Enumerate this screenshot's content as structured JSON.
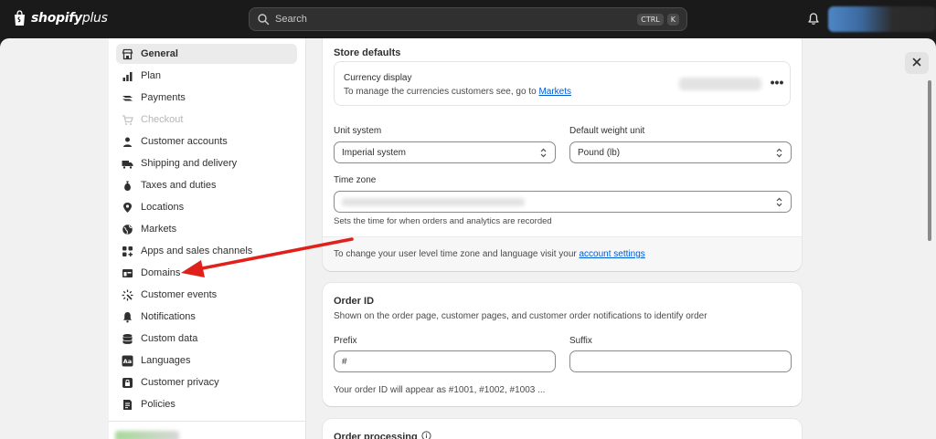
{
  "topbar": {
    "logo_text": "shopify",
    "logo_plus": "plus",
    "search_placeholder": "Search",
    "shortcut_key1": "CTRL",
    "shortcut_key2": "K"
  },
  "sidebar": {
    "items": [
      {
        "label": "General",
        "icon": "store-icon",
        "active": true
      },
      {
        "label": "Plan",
        "icon": "plan-icon"
      },
      {
        "label": "Payments",
        "icon": "payments-icon"
      },
      {
        "label": "Checkout",
        "icon": "cart-icon",
        "disabled": true
      },
      {
        "label": "Customer accounts",
        "icon": "person-icon"
      },
      {
        "label": "Shipping and delivery",
        "icon": "truck-icon"
      },
      {
        "label": "Taxes and duties",
        "icon": "tax-icon"
      },
      {
        "label": "Locations",
        "icon": "location-icon"
      },
      {
        "label": "Markets",
        "icon": "globe-icon"
      },
      {
        "label": "Apps and sales channels",
        "icon": "apps-icon"
      },
      {
        "label": "Domains",
        "icon": "domains-icon"
      },
      {
        "label": "Customer events",
        "icon": "events-icon"
      },
      {
        "label": "Notifications",
        "icon": "bell-icon"
      },
      {
        "label": "Custom data",
        "icon": "database-icon"
      },
      {
        "label": "Languages",
        "icon": "language-icon"
      },
      {
        "label": "Customer privacy",
        "icon": "lock-icon"
      },
      {
        "label": "Policies",
        "icon": "policy-icon"
      }
    ]
  },
  "store_defaults": {
    "title": "Store defaults",
    "currency_title": "Currency display",
    "currency_desc": "To manage the currencies customers see, go to",
    "currency_link": "Markets",
    "more": "•••",
    "unit_system_label": "Unit system",
    "unit_system_value": "Imperial system",
    "weight_label": "Default weight unit",
    "weight_value": "Pound (lb)",
    "timezone_label": "Time zone",
    "timezone_help": "Sets the time for when orders and analytics are recorded",
    "footer_text": "To change your user level time zone and language visit your",
    "footer_link": "account settings"
  },
  "order_id": {
    "title": "Order ID",
    "desc": "Shown on the order page, customer pages, and customer order notifications to identify order",
    "prefix_label": "Prefix",
    "prefix_value": "#",
    "suffix_label": "Suffix",
    "suffix_value": "",
    "preview": "Your order ID will appear as #1001, #1002, #1003 ..."
  },
  "order_processing": {
    "title": "Order processing"
  },
  "colors": {
    "accent_link": "#005bd3",
    "annotation_arrow": "#e0201b",
    "topbar": "#1a1a1a"
  }
}
